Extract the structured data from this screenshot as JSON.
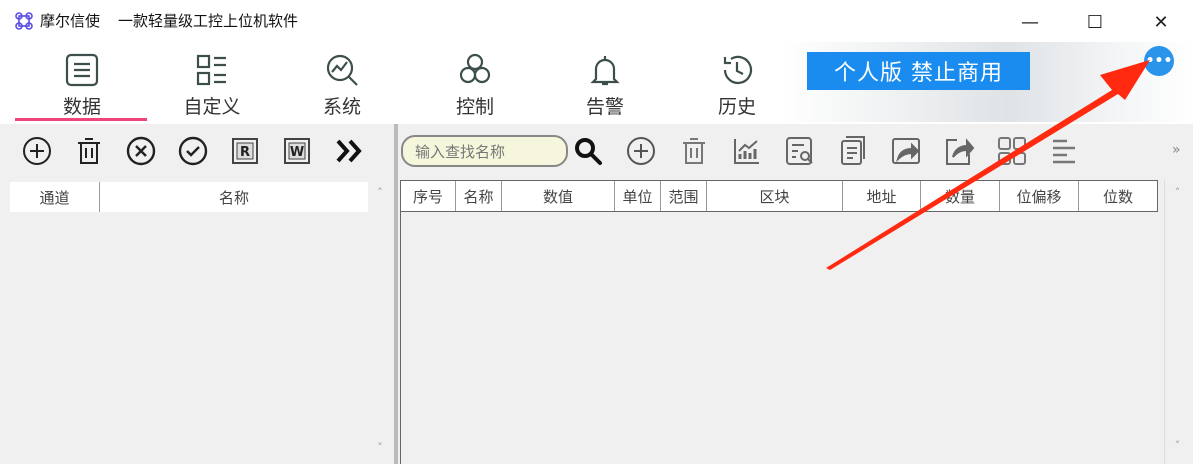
{
  "window": {
    "app_name": "摩尔信使",
    "subtitle": "一款轻量级工控上位机软件",
    "minimize": "—",
    "maximize": "☐",
    "close": "✕"
  },
  "badge": {
    "text": "个人版  禁止商用",
    "color": "#1a8cf0"
  },
  "more_button": "•••",
  "tabs": [
    {
      "label": "数据",
      "icon": "list-icon",
      "active": true
    },
    {
      "label": "自定义",
      "icon": "grid-list-icon"
    },
    {
      "label": "系统",
      "icon": "chart-search-icon"
    },
    {
      "label": "控制",
      "icon": "control-icon"
    },
    {
      "label": "告警",
      "icon": "bell-icon"
    },
    {
      "label": "历史",
      "icon": "history-icon"
    }
  ],
  "left_panel": {
    "toolbar": [
      "add-icon",
      "delete-icon",
      "cancel-icon",
      "confirm-icon",
      "read-icon",
      "write-icon",
      "expand-icon"
    ],
    "read_label": "R",
    "write_label": "W",
    "columns": [
      "通道",
      "名称"
    ]
  },
  "right_panel": {
    "search_placeholder": "输入查找名称",
    "overflow": "»",
    "columns": [
      "序号",
      "名称",
      "数值",
      "单位",
      "范围",
      "区块",
      "地址",
      "数量",
      "位偏移",
      "位数"
    ]
  },
  "scroll_up": "˄",
  "scroll_down": "˅",
  "colors": {
    "accent_underline": "#f0457a",
    "arrow": "#ff2a10",
    "icon": "#3d4f4c"
  }
}
